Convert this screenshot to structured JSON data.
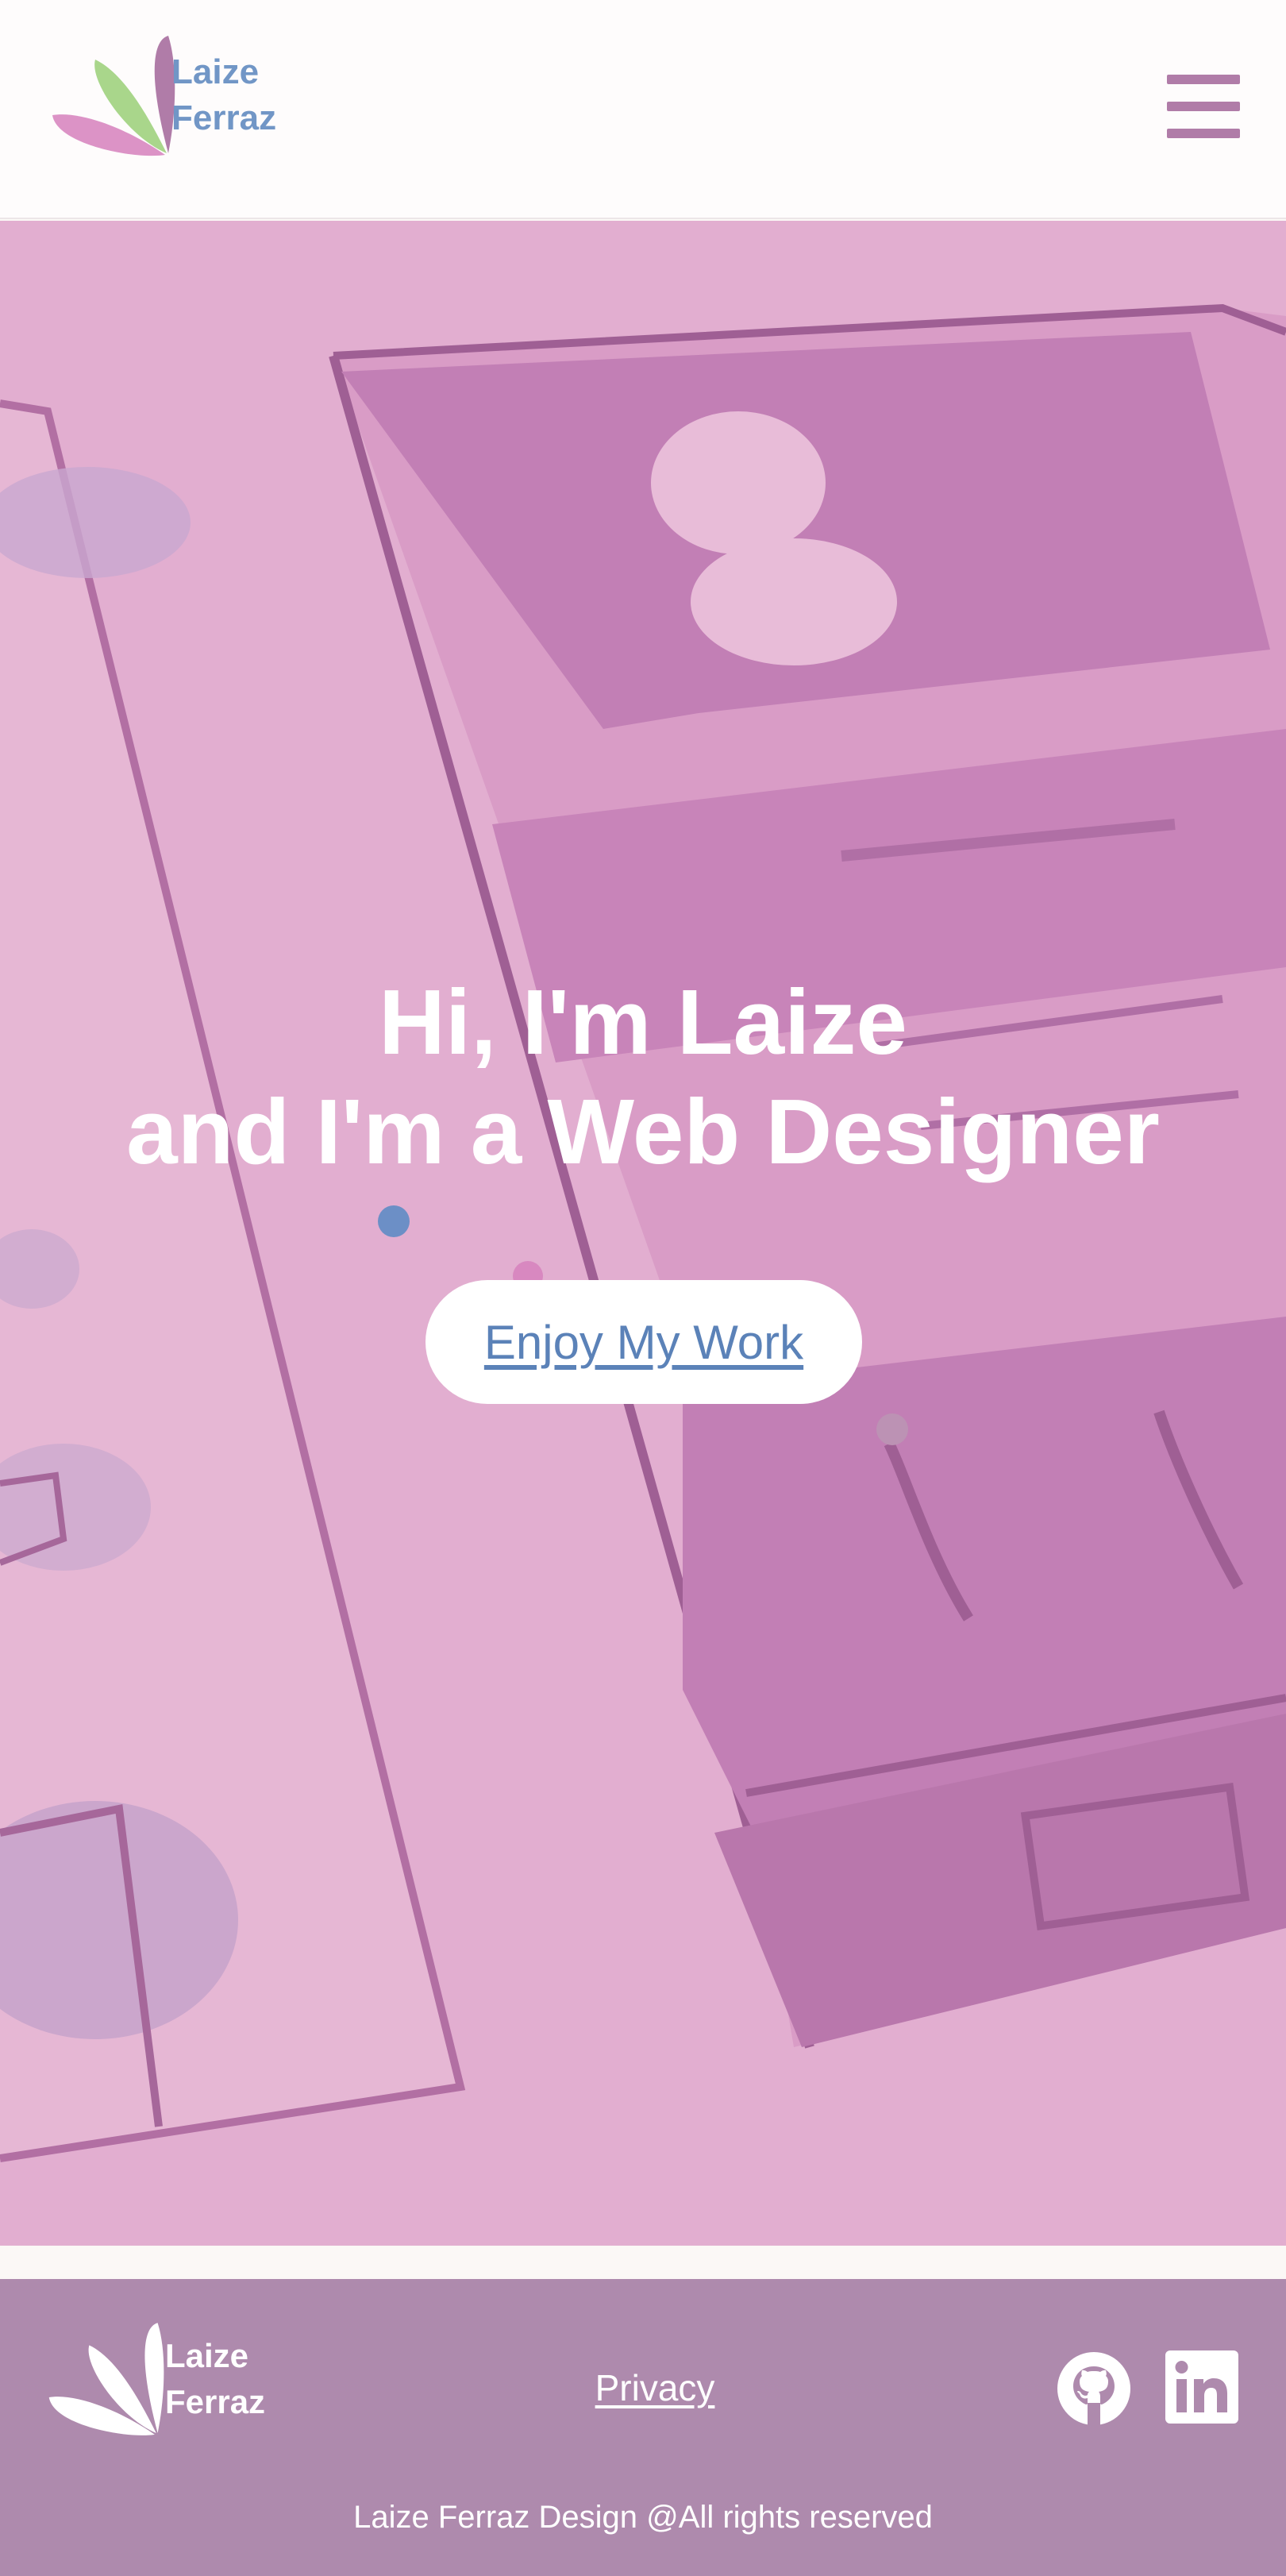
{
  "header": {
    "logo": {
      "line1": "Laize",
      "line2": "Ferraz",
      "icon": "fan-leaves-logo-icon"
    },
    "menu_icon": "hamburger-menu-icon"
  },
  "hero": {
    "title_line1": "Hi, I'm Laize",
    "title_line2": "and I'm a Web Designer",
    "cta_label": "Enjoy My Work",
    "background_image": "watercolor wireframe sketch"
  },
  "footer": {
    "logo": {
      "line1": "Laize",
      "line2": "Ferraz",
      "icon": "fan-leaves-logo-icon"
    },
    "privacy_label": "Privacy",
    "social": [
      {
        "icon": "github-icon"
      },
      {
        "icon": "linkedin-icon"
      }
    ],
    "copyright": "Laize Ferraz Design @All rights reserved"
  },
  "colors": {
    "brand_pink": "#e0acce",
    "brand_blue": "#7196c6",
    "brand_green": "#a9d68b",
    "footer_bg": "#ae8aad",
    "header_bg": "#fefcfc"
  }
}
